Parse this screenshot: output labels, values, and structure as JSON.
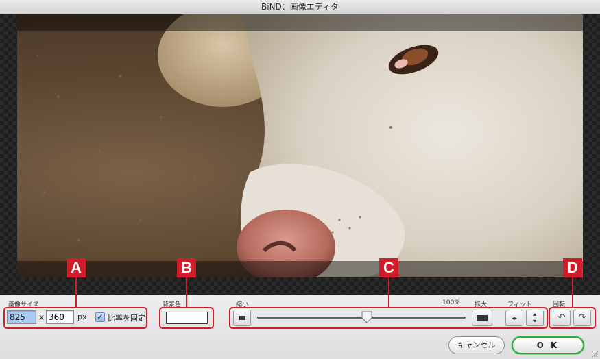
{
  "window": {
    "title": "BiND：画像エディタ"
  },
  "image_size": {
    "label": "画像サイズ",
    "width_value": "825",
    "x_separator": "x",
    "height_value": "360",
    "unit": "px",
    "lock_ratio_label": "比率を固定",
    "lock_ratio_checked": true
  },
  "background_color": {
    "label": "背景色",
    "value": "#ffffff"
  },
  "zoom": {
    "shrink_label": "縮小",
    "percent_label": "100%",
    "enlarge_label": "拡大",
    "fit_label": "フィット",
    "level": 0.5
  },
  "rotate": {
    "label": "回転"
  },
  "markers": [
    "A",
    "B",
    "C",
    "D"
  ],
  "actions": {
    "cancel_label": "キャンセル",
    "ok_label": "O K"
  },
  "colors": {
    "marker_red": "#d01d2c",
    "ok_green": "#2eaa3c",
    "selection_blue": "#a9c9f2"
  },
  "icons": [
    "rotate-left-icon",
    "rotate-right-icon",
    "fit-horizontal-icon",
    "fit-vertical-icon",
    "zoom-out-icon",
    "zoom-in-icon",
    "checkmark-icon",
    "resize-grip-icon"
  ]
}
